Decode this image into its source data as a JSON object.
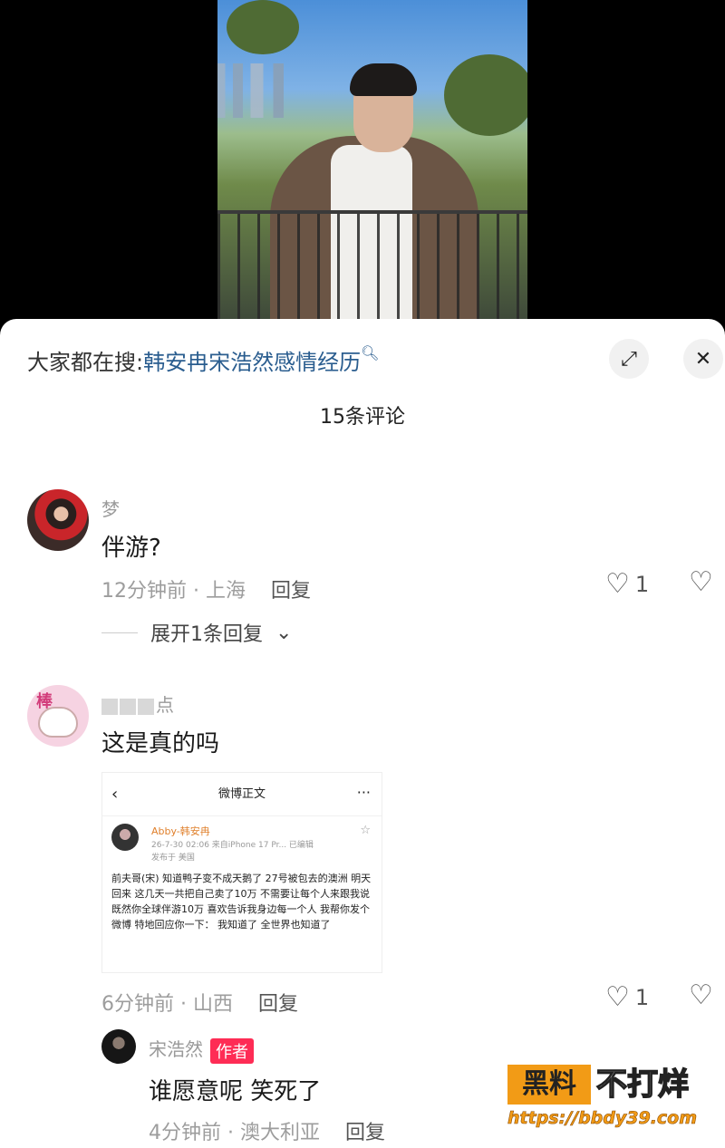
{
  "search": {
    "prefix": "大家都在搜:",
    "term": "韩安冉宋浩然感情经历",
    "search_icon": "magnifier-icon"
  },
  "header": {
    "comment_count_title": "15条评论",
    "expand_icon": "expand-icon",
    "close_icon": "close-icon"
  },
  "comments": [
    {
      "username": "梦",
      "text": "伴游?",
      "time": "12分钟前",
      "location": "上海",
      "reply_label": "回复",
      "likes": "1",
      "expand_replies_label": "展开1条回复"
    },
    {
      "username": "点",
      "text": "这是真的吗",
      "time": "6分钟前",
      "location": "山西",
      "reply_label": "回复",
      "likes": "1",
      "embedded_post": {
        "nav_title": "微博正文",
        "author": "Abby-韩安冉",
        "time_device": "26-7-30 02:06  来自iPhone 17 Pr...  已编辑",
        "posted_from": "发布于 美国",
        "body": "前夫哥(宋) 知道鸭子变不成天鹅了 27号被包去的澳洲 明天回来 这几天一共把自己卖了10万 不需要让每个人来跟我说 既然你全球伴游10万 喜欢告诉我身边每一个人 我帮你发个微博 特地回应你一下： 我知道了 全世界也知道了"
      }
    }
  ],
  "reply": {
    "username": "宋浩然",
    "author_badge": "作者",
    "text": "谁愿意呢 笑死了",
    "time": "4分钟前",
    "location": "澳大利亚",
    "reply_label": "回复"
  },
  "watermark": {
    "badge": "黑料",
    "title": "不打烊",
    "url": "https://bbdy39.com"
  },
  "colors": {
    "accent_link": "#2a5d8f",
    "author_badge": "#fe2c55",
    "watermark_orange": "#f29b16"
  }
}
